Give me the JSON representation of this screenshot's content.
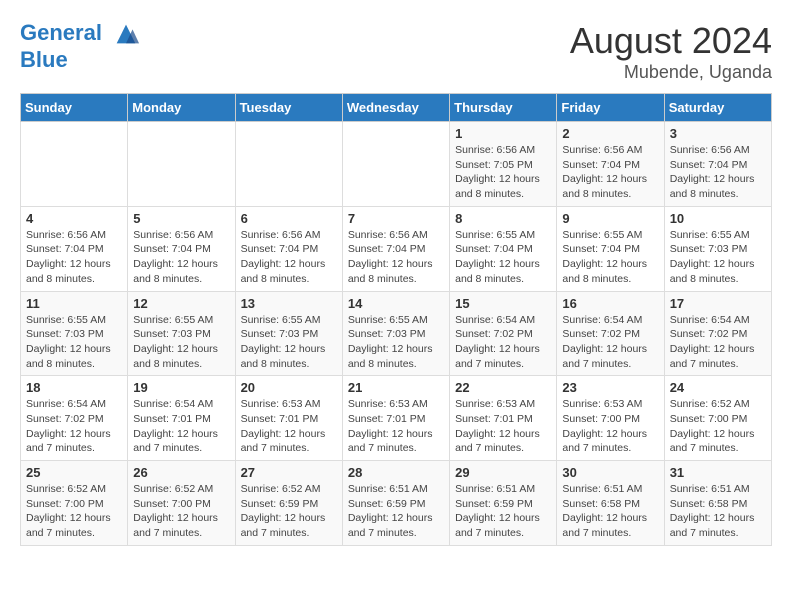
{
  "header": {
    "logo_line1": "General",
    "logo_line2": "Blue",
    "main_title": "August 2024",
    "sub_title": "Mubende, Uganda"
  },
  "days_of_week": [
    "Sunday",
    "Monday",
    "Tuesday",
    "Wednesday",
    "Thursday",
    "Friday",
    "Saturday"
  ],
  "weeks": [
    [
      {
        "day": "",
        "info": ""
      },
      {
        "day": "",
        "info": ""
      },
      {
        "day": "",
        "info": ""
      },
      {
        "day": "",
        "info": ""
      },
      {
        "day": "1",
        "info": "Sunrise: 6:56 AM\nSunset: 7:05 PM\nDaylight: 12 hours\nand 8 minutes."
      },
      {
        "day": "2",
        "info": "Sunrise: 6:56 AM\nSunset: 7:04 PM\nDaylight: 12 hours\nand 8 minutes."
      },
      {
        "day": "3",
        "info": "Sunrise: 6:56 AM\nSunset: 7:04 PM\nDaylight: 12 hours\nand 8 minutes."
      }
    ],
    [
      {
        "day": "4",
        "info": "Sunrise: 6:56 AM\nSunset: 7:04 PM\nDaylight: 12 hours\nand 8 minutes."
      },
      {
        "day": "5",
        "info": "Sunrise: 6:56 AM\nSunset: 7:04 PM\nDaylight: 12 hours\nand 8 minutes."
      },
      {
        "day": "6",
        "info": "Sunrise: 6:56 AM\nSunset: 7:04 PM\nDaylight: 12 hours\nand 8 minutes."
      },
      {
        "day": "7",
        "info": "Sunrise: 6:56 AM\nSunset: 7:04 PM\nDaylight: 12 hours\nand 8 minutes."
      },
      {
        "day": "8",
        "info": "Sunrise: 6:55 AM\nSunset: 7:04 PM\nDaylight: 12 hours\nand 8 minutes."
      },
      {
        "day": "9",
        "info": "Sunrise: 6:55 AM\nSunset: 7:04 PM\nDaylight: 12 hours\nand 8 minutes."
      },
      {
        "day": "10",
        "info": "Sunrise: 6:55 AM\nSunset: 7:03 PM\nDaylight: 12 hours\nand 8 minutes."
      }
    ],
    [
      {
        "day": "11",
        "info": "Sunrise: 6:55 AM\nSunset: 7:03 PM\nDaylight: 12 hours\nand 8 minutes."
      },
      {
        "day": "12",
        "info": "Sunrise: 6:55 AM\nSunset: 7:03 PM\nDaylight: 12 hours\nand 8 minutes."
      },
      {
        "day": "13",
        "info": "Sunrise: 6:55 AM\nSunset: 7:03 PM\nDaylight: 12 hours\nand 8 minutes."
      },
      {
        "day": "14",
        "info": "Sunrise: 6:55 AM\nSunset: 7:03 PM\nDaylight: 12 hours\nand 8 minutes."
      },
      {
        "day": "15",
        "info": "Sunrise: 6:54 AM\nSunset: 7:02 PM\nDaylight: 12 hours\nand 7 minutes."
      },
      {
        "day": "16",
        "info": "Sunrise: 6:54 AM\nSunset: 7:02 PM\nDaylight: 12 hours\nand 7 minutes."
      },
      {
        "day": "17",
        "info": "Sunrise: 6:54 AM\nSunset: 7:02 PM\nDaylight: 12 hours\nand 7 minutes."
      }
    ],
    [
      {
        "day": "18",
        "info": "Sunrise: 6:54 AM\nSunset: 7:02 PM\nDaylight: 12 hours\nand 7 minutes."
      },
      {
        "day": "19",
        "info": "Sunrise: 6:54 AM\nSunset: 7:01 PM\nDaylight: 12 hours\nand 7 minutes."
      },
      {
        "day": "20",
        "info": "Sunrise: 6:53 AM\nSunset: 7:01 PM\nDaylight: 12 hours\nand 7 minutes."
      },
      {
        "day": "21",
        "info": "Sunrise: 6:53 AM\nSunset: 7:01 PM\nDaylight: 12 hours\nand 7 minutes."
      },
      {
        "day": "22",
        "info": "Sunrise: 6:53 AM\nSunset: 7:01 PM\nDaylight: 12 hours\nand 7 minutes."
      },
      {
        "day": "23",
        "info": "Sunrise: 6:53 AM\nSunset: 7:00 PM\nDaylight: 12 hours\nand 7 minutes."
      },
      {
        "day": "24",
        "info": "Sunrise: 6:52 AM\nSunset: 7:00 PM\nDaylight: 12 hours\nand 7 minutes."
      }
    ],
    [
      {
        "day": "25",
        "info": "Sunrise: 6:52 AM\nSunset: 7:00 PM\nDaylight: 12 hours\nand 7 minutes."
      },
      {
        "day": "26",
        "info": "Sunrise: 6:52 AM\nSunset: 7:00 PM\nDaylight: 12 hours\nand 7 minutes."
      },
      {
        "day": "27",
        "info": "Sunrise: 6:52 AM\nSunset: 6:59 PM\nDaylight: 12 hours\nand 7 minutes."
      },
      {
        "day": "28",
        "info": "Sunrise: 6:51 AM\nSunset: 6:59 PM\nDaylight: 12 hours\nand 7 minutes."
      },
      {
        "day": "29",
        "info": "Sunrise: 6:51 AM\nSunset: 6:59 PM\nDaylight: 12 hours\nand 7 minutes."
      },
      {
        "day": "30",
        "info": "Sunrise: 6:51 AM\nSunset: 6:58 PM\nDaylight: 12 hours\nand 7 minutes."
      },
      {
        "day": "31",
        "info": "Sunrise: 6:51 AM\nSunset: 6:58 PM\nDaylight: 12 hours\nand 7 minutes."
      }
    ]
  ]
}
